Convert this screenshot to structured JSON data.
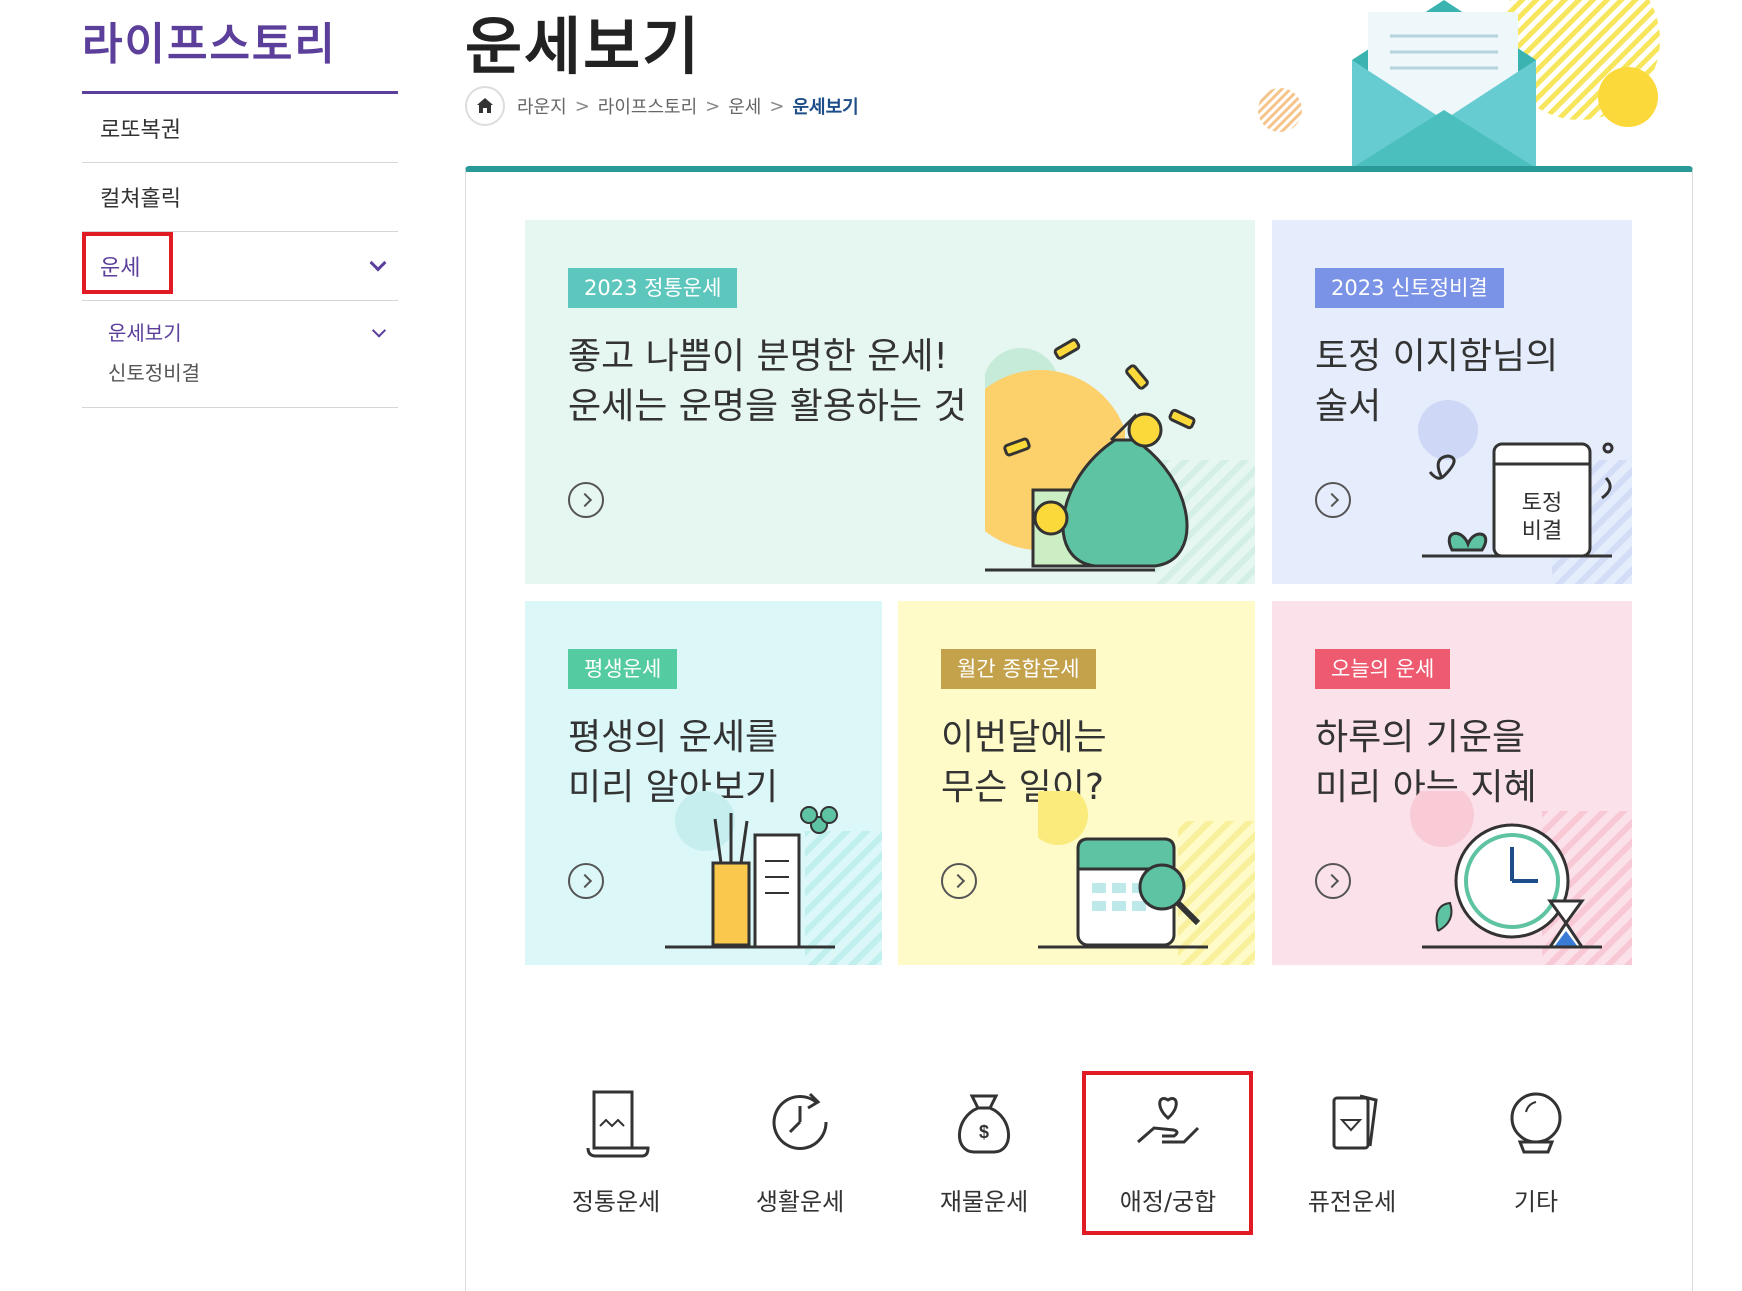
{
  "sidebar": {
    "brand": "라이프스토리",
    "items": [
      {
        "label": "로또복권"
      },
      {
        "label": "컬쳐홀릭"
      },
      {
        "label": "운세"
      }
    ],
    "sub_items": [
      {
        "label": "운세보기"
      },
      {
        "label": "신토정비결"
      }
    ]
  },
  "header": {
    "title": "운세보기",
    "breadcrumb": [
      "라운지",
      "라이프스토리",
      "운세",
      "운세보기"
    ]
  },
  "cards": [
    {
      "tag": "2023 정통운세",
      "tag_color": "#5ec7bd",
      "headline": "좋고 나쁨이 분명한 운세!\n운세는 운명을 활용하는 것"
    },
    {
      "tag": "2023 신토정비결",
      "tag_color": "#7b93e6",
      "headline": "토정 이지함님의\n술서",
      "book_text": "토정\n비결"
    },
    {
      "tag": "평생운세",
      "tag_color": "#54cba0",
      "headline": "평생의 운세를\n미리 알아보기"
    },
    {
      "tag": "월간 종합운세",
      "tag_color": "#c4a24c",
      "headline": "이번달에는\n무슨 일이?"
    },
    {
      "tag": "오늘의 운세",
      "tag_color": "#ee5a6f",
      "headline": "하루의 기운을\n미리 아는 지혜"
    }
  ],
  "categories": [
    {
      "label": "정통운세",
      "icon": "scroll-icon"
    },
    {
      "label": "생활운세",
      "icon": "clock-cycle-icon"
    },
    {
      "label": "재물운세",
      "icon": "money-bag-icon"
    },
    {
      "label": "애정/궁합",
      "icon": "heart-hand-icon"
    },
    {
      "label": "퓨전운세",
      "icon": "cards-icon"
    },
    {
      "label": "기타",
      "icon": "crystal-ball-icon"
    }
  ],
  "colors": {
    "brand": "#5b3f9b",
    "accent": "#2a9a99",
    "highlight": "#e01b24"
  }
}
